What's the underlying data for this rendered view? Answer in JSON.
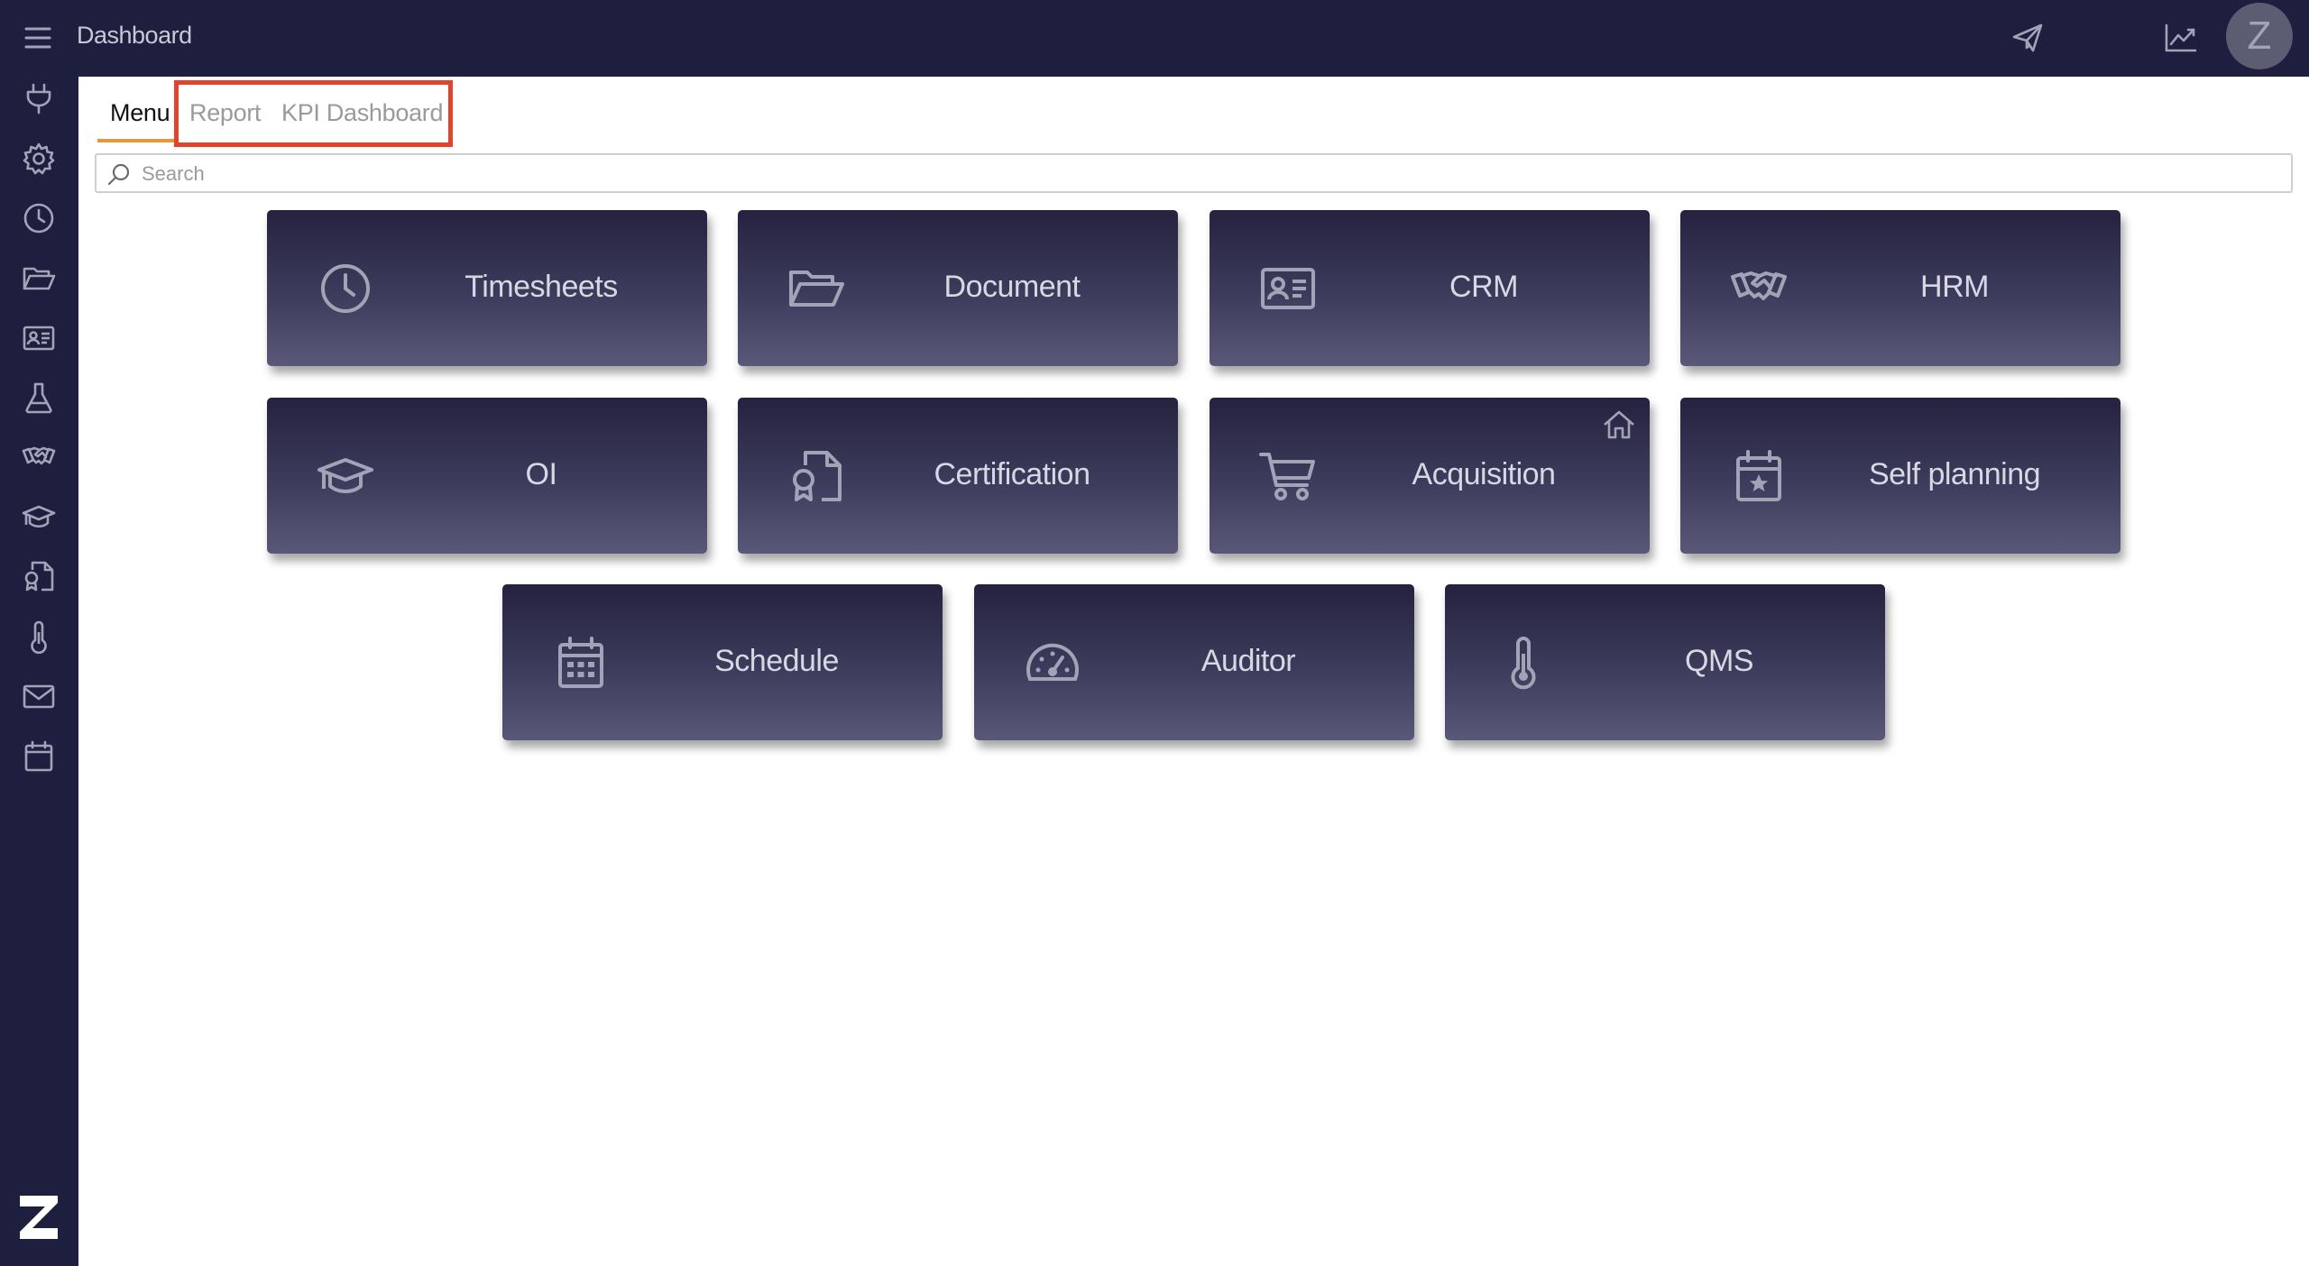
{
  "header": {
    "title": "Dashboard",
    "avatar_initial": "Z",
    "icons": [
      "paper-plane-icon",
      "line-chart-icon"
    ]
  },
  "sidebar": {
    "icons": [
      "plug-icon",
      "gear-icon",
      "clock-icon",
      "folder-open-icon",
      "contact-card-icon",
      "flask-icon",
      "handshake-icon",
      "graduation-cap-icon",
      "certificate-file-icon",
      "thermometer-icon",
      "envelope-icon",
      "calendar-icon"
    ]
  },
  "tabs": [
    {
      "label": "Menu",
      "active": true
    },
    {
      "label": "Report",
      "active": false
    },
    {
      "label": "KPI Dashboard",
      "active": false
    }
  ],
  "search": {
    "placeholder": "Search",
    "value": ""
  },
  "tiles": [
    {
      "label": "Timesheets",
      "icon": "clock-icon"
    },
    {
      "label": "Document",
      "icon": "folder-open-icon"
    },
    {
      "label": "CRM",
      "icon": "contact-card-icon"
    },
    {
      "label": "HRM",
      "icon": "handshake-icon"
    },
    {
      "label": "OI",
      "icon": "graduation-cap-icon"
    },
    {
      "label": "Certification",
      "icon": "certificate-file-icon"
    },
    {
      "label": "Acquisition",
      "icon": "shopping-cart-icon",
      "badge_icon": "home-icon"
    },
    {
      "label": "Self planning",
      "icon": "calendar-star-icon"
    },
    {
      "label": "Schedule",
      "icon": "calendar-grid-icon"
    },
    {
      "label": "Auditor",
      "icon": "gauge-icon"
    },
    {
      "label": "QMS",
      "icon": "thermometer-icon"
    }
  ],
  "colors": {
    "chrome": "#1e1e3f",
    "tab_accent": "#e5973a",
    "highlight_box": "#e0442d",
    "tile_text": "#d8d8e4",
    "icon": "#a3a3b8"
  }
}
